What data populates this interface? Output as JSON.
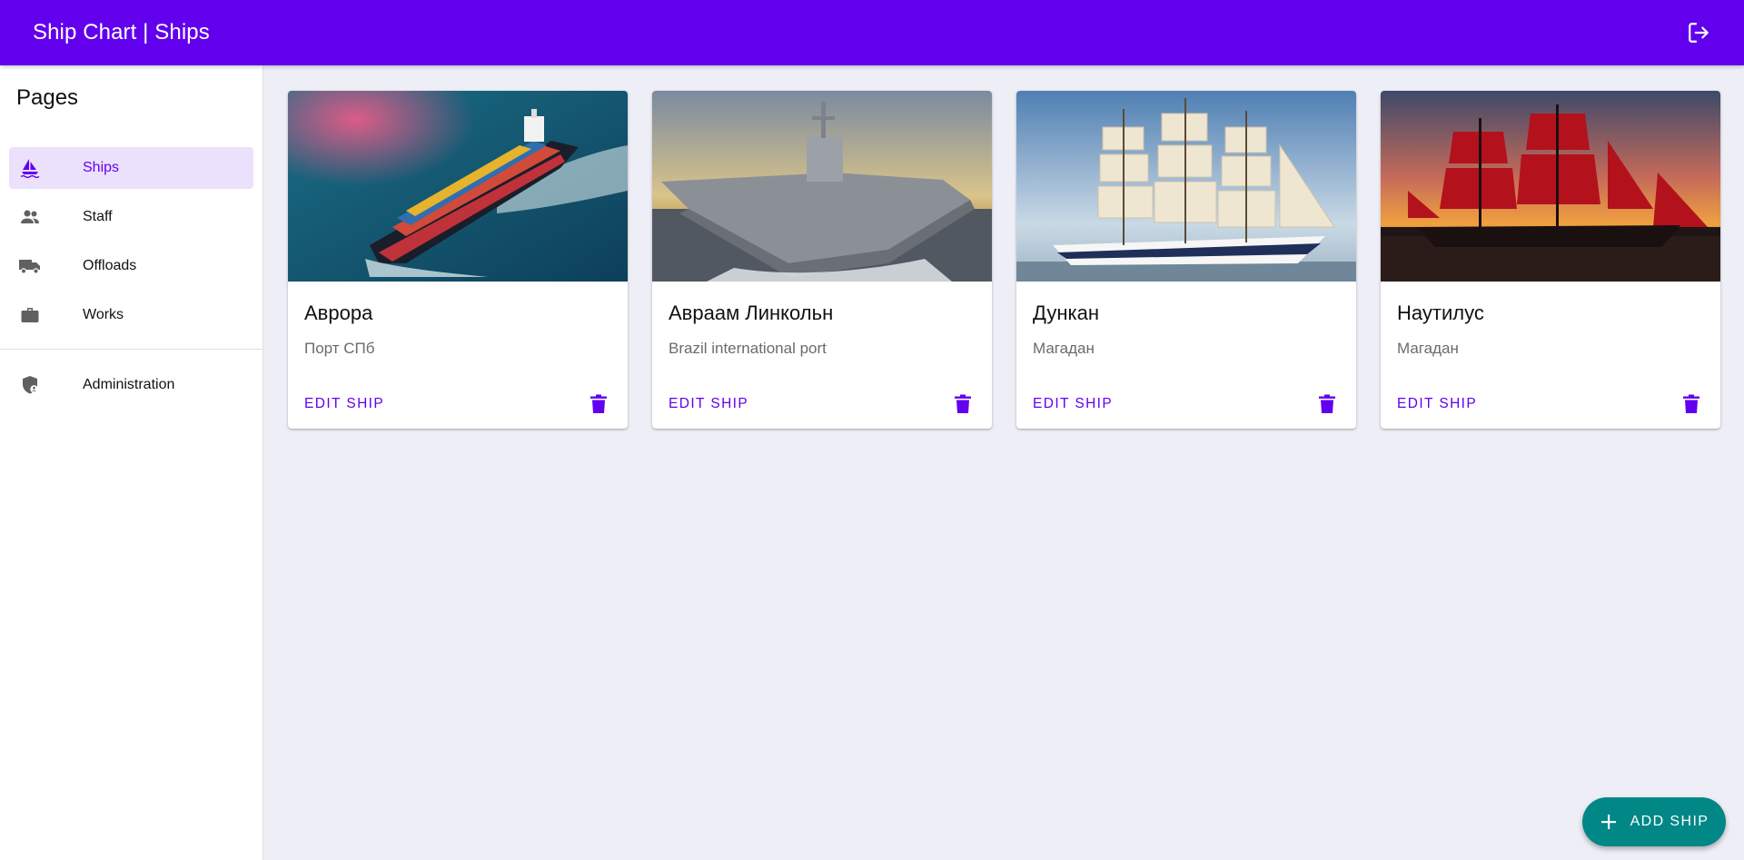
{
  "appbar": {
    "title": "Ship Chart | Ships",
    "logout_icon": "logout-icon"
  },
  "sidebar": {
    "heading": "Pages",
    "items": [
      {
        "label": "Ships",
        "icon": "sailboat-icon",
        "active": true
      },
      {
        "label": "Staff",
        "icon": "people-icon",
        "active": false
      },
      {
        "label": "Offloads",
        "icon": "truck-icon",
        "active": false
      },
      {
        "label": "Works",
        "icon": "briefcase-icon",
        "active": false
      }
    ],
    "admin_item": {
      "label": "Administration",
      "icon": "admin-shield-icon"
    }
  },
  "ships": [
    {
      "name": "Аврора",
      "port": "Порт СПб",
      "image": "cargo-ship-photo",
      "edit_label": "EDIT SHIP"
    },
    {
      "name": "Авраам Линкольн",
      "port": "Brazil international port",
      "image": "warship-photo",
      "edit_label": "EDIT SHIP"
    },
    {
      "name": "Дункан",
      "port": "Магадан",
      "image": "sailing-ship-photo",
      "edit_label": "EDIT SHIP"
    },
    {
      "name": "Наутилус",
      "port": "Магадан",
      "image": "red-sails-ship-photo",
      "edit_label": "EDIT SHIP"
    }
  ],
  "fab": {
    "label": "ADD SHIP",
    "icon": "plus-icon"
  },
  "colors": {
    "primary": "#6200ee",
    "secondary": "#018786",
    "active_nav_bg": "#ece1fc",
    "background": "#eeeef6"
  }
}
